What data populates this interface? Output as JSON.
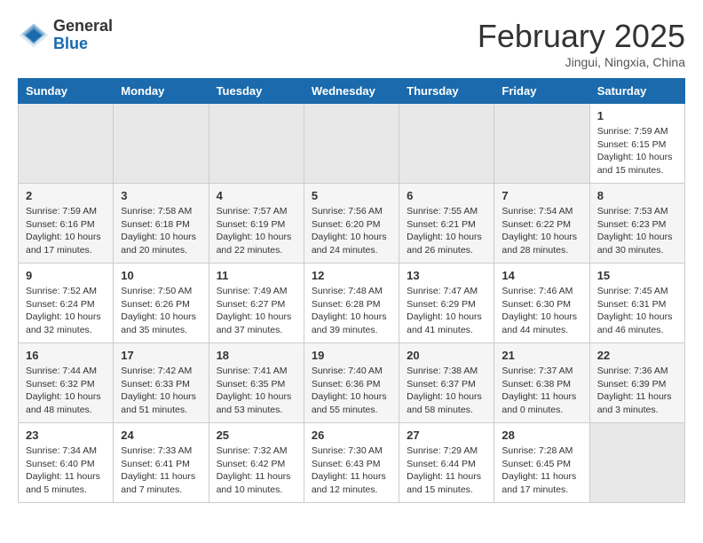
{
  "header": {
    "logo_general": "General",
    "logo_blue": "Blue",
    "title": "February 2025",
    "subtitle": "Jingui, Ningxia, China"
  },
  "days_of_week": [
    "Sunday",
    "Monday",
    "Tuesday",
    "Wednesday",
    "Thursday",
    "Friday",
    "Saturday"
  ],
  "weeks": [
    [
      {
        "day": "",
        "info": ""
      },
      {
        "day": "",
        "info": ""
      },
      {
        "day": "",
        "info": ""
      },
      {
        "day": "",
        "info": ""
      },
      {
        "day": "",
        "info": ""
      },
      {
        "day": "",
        "info": ""
      },
      {
        "day": "1",
        "info": "Sunrise: 7:59 AM\nSunset: 6:15 PM\nDaylight: 10 hours and 15 minutes."
      }
    ],
    [
      {
        "day": "2",
        "info": "Sunrise: 7:59 AM\nSunset: 6:16 PM\nDaylight: 10 hours and 17 minutes."
      },
      {
        "day": "3",
        "info": "Sunrise: 7:58 AM\nSunset: 6:18 PM\nDaylight: 10 hours and 20 minutes."
      },
      {
        "day": "4",
        "info": "Sunrise: 7:57 AM\nSunset: 6:19 PM\nDaylight: 10 hours and 22 minutes."
      },
      {
        "day": "5",
        "info": "Sunrise: 7:56 AM\nSunset: 6:20 PM\nDaylight: 10 hours and 24 minutes."
      },
      {
        "day": "6",
        "info": "Sunrise: 7:55 AM\nSunset: 6:21 PM\nDaylight: 10 hours and 26 minutes."
      },
      {
        "day": "7",
        "info": "Sunrise: 7:54 AM\nSunset: 6:22 PM\nDaylight: 10 hours and 28 minutes."
      },
      {
        "day": "8",
        "info": "Sunrise: 7:53 AM\nSunset: 6:23 PM\nDaylight: 10 hours and 30 minutes."
      }
    ],
    [
      {
        "day": "9",
        "info": "Sunrise: 7:52 AM\nSunset: 6:24 PM\nDaylight: 10 hours and 32 minutes."
      },
      {
        "day": "10",
        "info": "Sunrise: 7:50 AM\nSunset: 6:26 PM\nDaylight: 10 hours and 35 minutes."
      },
      {
        "day": "11",
        "info": "Sunrise: 7:49 AM\nSunset: 6:27 PM\nDaylight: 10 hours and 37 minutes."
      },
      {
        "day": "12",
        "info": "Sunrise: 7:48 AM\nSunset: 6:28 PM\nDaylight: 10 hours and 39 minutes."
      },
      {
        "day": "13",
        "info": "Sunrise: 7:47 AM\nSunset: 6:29 PM\nDaylight: 10 hours and 41 minutes."
      },
      {
        "day": "14",
        "info": "Sunrise: 7:46 AM\nSunset: 6:30 PM\nDaylight: 10 hours and 44 minutes."
      },
      {
        "day": "15",
        "info": "Sunrise: 7:45 AM\nSunset: 6:31 PM\nDaylight: 10 hours and 46 minutes."
      }
    ],
    [
      {
        "day": "16",
        "info": "Sunrise: 7:44 AM\nSunset: 6:32 PM\nDaylight: 10 hours and 48 minutes."
      },
      {
        "day": "17",
        "info": "Sunrise: 7:42 AM\nSunset: 6:33 PM\nDaylight: 10 hours and 51 minutes."
      },
      {
        "day": "18",
        "info": "Sunrise: 7:41 AM\nSunset: 6:35 PM\nDaylight: 10 hours and 53 minutes."
      },
      {
        "day": "19",
        "info": "Sunrise: 7:40 AM\nSunset: 6:36 PM\nDaylight: 10 hours and 55 minutes."
      },
      {
        "day": "20",
        "info": "Sunrise: 7:38 AM\nSunset: 6:37 PM\nDaylight: 10 hours and 58 minutes."
      },
      {
        "day": "21",
        "info": "Sunrise: 7:37 AM\nSunset: 6:38 PM\nDaylight: 11 hours and 0 minutes."
      },
      {
        "day": "22",
        "info": "Sunrise: 7:36 AM\nSunset: 6:39 PM\nDaylight: 11 hours and 3 minutes."
      }
    ],
    [
      {
        "day": "23",
        "info": "Sunrise: 7:34 AM\nSunset: 6:40 PM\nDaylight: 11 hours and 5 minutes."
      },
      {
        "day": "24",
        "info": "Sunrise: 7:33 AM\nSunset: 6:41 PM\nDaylight: 11 hours and 7 minutes."
      },
      {
        "day": "25",
        "info": "Sunrise: 7:32 AM\nSunset: 6:42 PM\nDaylight: 11 hours and 10 minutes."
      },
      {
        "day": "26",
        "info": "Sunrise: 7:30 AM\nSunset: 6:43 PM\nDaylight: 11 hours and 12 minutes."
      },
      {
        "day": "27",
        "info": "Sunrise: 7:29 AM\nSunset: 6:44 PM\nDaylight: 11 hours and 15 minutes."
      },
      {
        "day": "28",
        "info": "Sunrise: 7:28 AM\nSunset: 6:45 PM\nDaylight: 11 hours and 17 minutes."
      },
      {
        "day": "",
        "info": ""
      }
    ]
  ]
}
